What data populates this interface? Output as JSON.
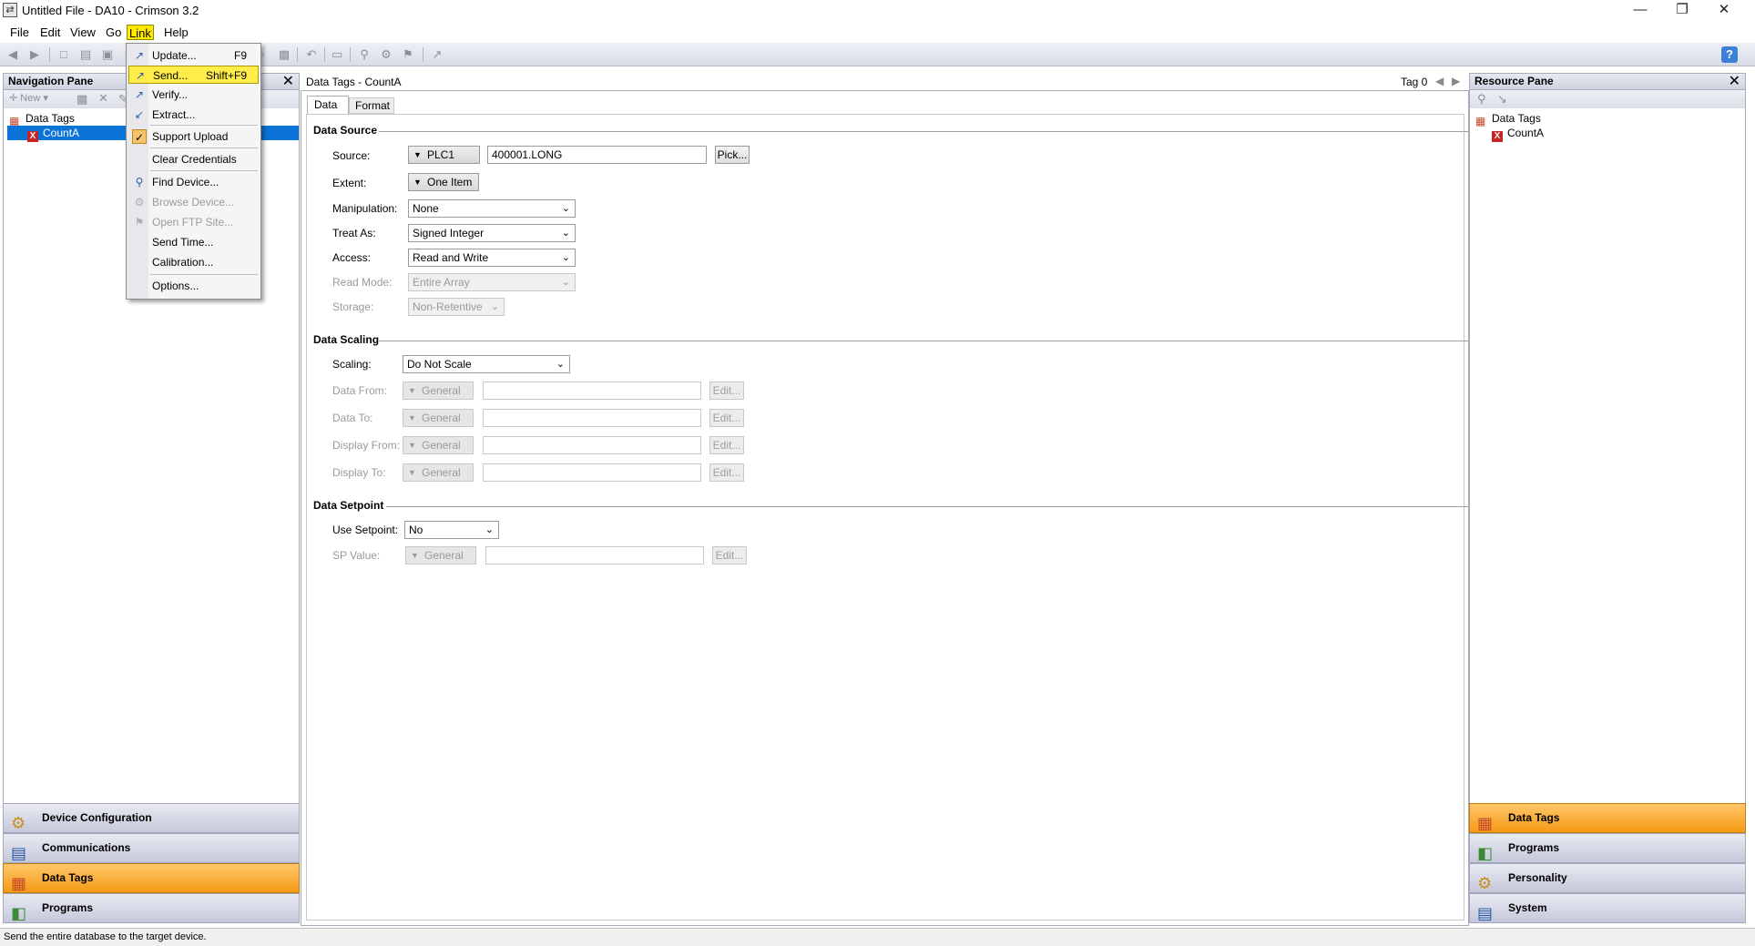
{
  "window": {
    "title": "Untitled File - DA10 - Crimson 3.2"
  },
  "menubar": {
    "items": [
      "File",
      "Edit",
      "View",
      "Go",
      "Link",
      "Help"
    ]
  },
  "link_menu": {
    "items": [
      {
        "label": "Update...",
        "shortcut": "F9"
      },
      {
        "label": "Send...",
        "shortcut": "Shift+F9"
      },
      {
        "label": "Verify..."
      },
      {
        "label": "Extract..."
      },
      {
        "label": "Support Upload"
      },
      {
        "label": "Clear Credentials"
      },
      {
        "label": "Find Device..."
      },
      {
        "label": "Browse Device..."
      },
      {
        "label": "Open FTP Site..."
      },
      {
        "label": "Send Time..."
      },
      {
        "label": "Calibration..."
      },
      {
        "label": "Options..."
      }
    ]
  },
  "nav_pane": {
    "title": "Navigation Pane",
    "new_label": "New",
    "tree_root": "Data Tags",
    "tree_item": "CountA",
    "categories": [
      "Device Configuration",
      "Communications",
      "Data Tags",
      "Programs"
    ]
  },
  "editor": {
    "title": "Data Tags - CountA",
    "tag_label": "Tag 0",
    "tabs": [
      "Data",
      "Format"
    ],
    "data_source": {
      "heading": "Data Source",
      "source_label": "Source:",
      "source_device": "PLC1",
      "source_address": "400001.LONG",
      "pick_button": "Pick...",
      "extent_label": "Extent:",
      "extent_value": "One Item",
      "manipulation_label": "Manipulation:",
      "manipulation_value": "None",
      "treat_as_label": "Treat As:",
      "treat_as_value": "Signed Integer",
      "access_label": "Access:",
      "access_value": "Read and Write",
      "read_mode_label": "Read Mode:",
      "read_mode_value": "Entire Array",
      "storage_label": "Storage:",
      "storage_value": "Non-Retentive"
    },
    "data_scaling": {
      "heading": "Data Scaling",
      "scaling_label": "Scaling:",
      "scaling_value": "Do Not Scale",
      "rows": [
        {
          "label": "Data From:",
          "type": "General",
          "edit": "Edit..."
        },
        {
          "label": "Data To:",
          "type": "General",
          "edit": "Edit..."
        },
        {
          "label": "Display From:",
          "type": "General",
          "edit": "Edit..."
        },
        {
          "label": "Display To:",
          "type": "General",
          "edit": "Edit..."
        }
      ]
    },
    "data_setpoint": {
      "heading": "Data Setpoint",
      "use_label": "Use Setpoint:",
      "use_value": "No",
      "sp_label": "SP Value:",
      "sp_type": "General",
      "sp_edit": "Edit..."
    }
  },
  "resource_pane": {
    "title": "Resource Pane",
    "tree_root": "Data Tags",
    "tree_item": "CountA",
    "categories": [
      "Data Tags",
      "Programs",
      "Personality",
      "System"
    ]
  },
  "statusbar": {
    "text": "Send the entire database to the target device."
  },
  "colors": {
    "selection": "#0a74d8",
    "highlight": "#ffea00",
    "category_selected": "#f59a16"
  }
}
